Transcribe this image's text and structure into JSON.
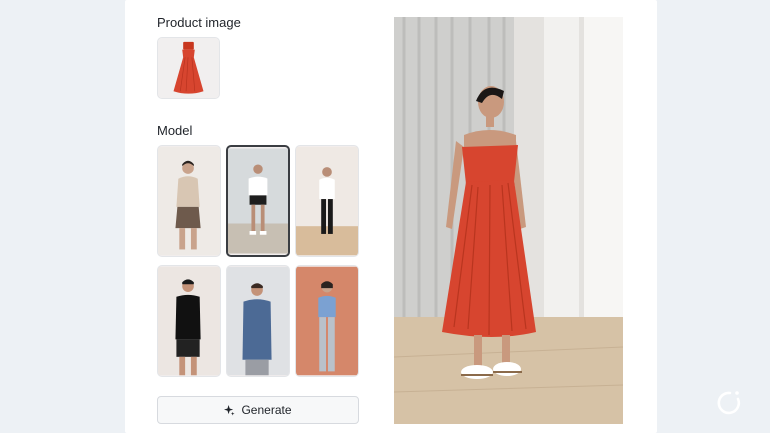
{
  "product": {
    "title": "Product image",
    "item": "red-strapless-dress"
  },
  "model": {
    "title": "Model",
    "selected_index": 1,
    "options": [
      {
        "name": "model-1",
        "top_color": "#d8c6b3",
        "bottom_color": "#6e5a4c",
        "bg": "#eeeae6"
      },
      {
        "name": "model-2",
        "top_color": "#ffffff",
        "bottom_color": "#1e1e1e",
        "bg": "#d6dadc"
      },
      {
        "name": "model-3",
        "top_color": "#ffffff",
        "bottom_color": "#1a1a1a",
        "bg": "#efe9e4"
      },
      {
        "name": "model-4",
        "top_color": "#111111",
        "bottom_color": "#222222",
        "bg": "#ece6e2"
      },
      {
        "name": "model-5",
        "top_color": "#4c6a95",
        "bottom_color": "#9a9da4",
        "bg": "#dfe1e4"
      },
      {
        "name": "model-6",
        "top_color": "#7ba1d2",
        "bottom_color": "#b9c1ca",
        "bg": "#d5876a"
      }
    ]
  },
  "actions": {
    "generate_label": "Generate"
  },
  "result": {
    "dress_color": "#d7452f"
  },
  "colors": {
    "accent_dress": "#d7452f",
    "button_border": "#d7dadf",
    "page_bg": "#edf1f5"
  },
  "icons": {
    "generate": "sparkle-icon",
    "brand": "brand-logo-icon"
  }
}
